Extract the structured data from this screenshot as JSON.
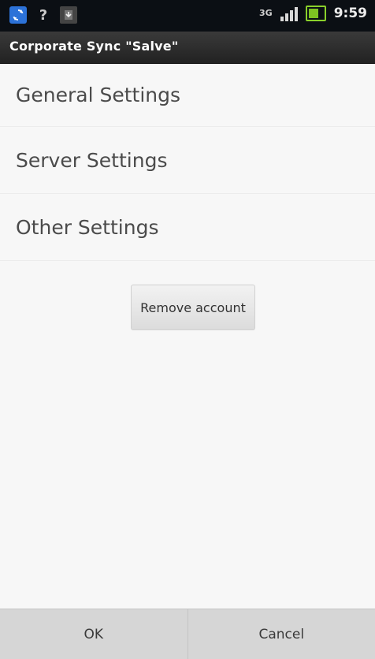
{
  "status_bar": {
    "network_label": "3G",
    "time": "9:59"
  },
  "title_bar": {
    "title": "Corporate Sync \"Salve\""
  },
  "settings": {
    "items": [
      {
        "label": "General Settings"
      },
      {
        "label": "Server Settings"
      },
      {
        "label": "Other Settings"
      }
    ]
  },
  "actions": {
    "remove_account_label": "Remove account",
    "ok_label": "OK",
    "cancel_label": "Cancel"
  },
  "icons": {
    "status_left": [
      "sync-icon",
      "question-icon",
      "download-icon"
    ],
    "status_right": [
      "network-icon",
      "signal-icon",
      "battery-icon"
    ]
  },
  "colors": {
    "status_bar_bg": "#0b0f14",
    "title_bar_bg": "#2a2a2a",
    "accent_sync": "#2c72d8",
    "battery": "#7ec322"
  }
}
